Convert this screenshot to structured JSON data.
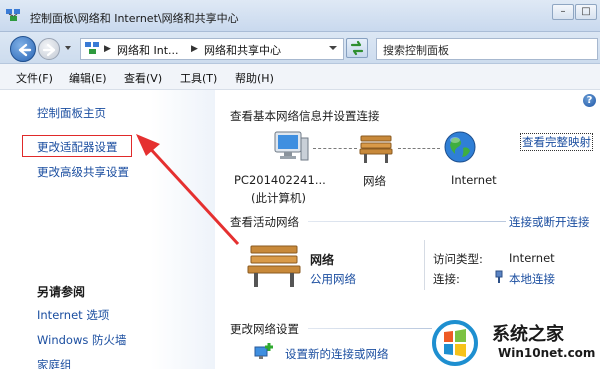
{
  "window": {
    "title": "控制面板\\网络和 Internet\\网络和共享中心",
    "minimize_label": "–",
    "maximize_label": "□"
  },
  "addressbar": {
    "crumbs": [
      "网络和 Int...",
      "网络和共享中心"
    ],
    "search_placeholder": "搜索控制面板"
  },
  "menu": {
    "items": [
      "文件(F)",
      "编辑(E)",
      "查看(V)",
      "工具(T)",
      "帮助(H)"
    ]
  },
  "sidebar": {
    "links": [
      "控制面板主页",
      "更改适配器设置",
      "更改高级共享设置"
    ],
    "see_also_heading": "另请参阅",
    "see_also": [
      "Internet 选项",
      "Windows 防火墙",
      "家庭组"
    ]
  },
  "main": {
    "basic_title": "查看基本网络信息并设置连接",
    "full_map_link": "查看完整映射",
    "nodes": {
      "computer_name": "PC201402241...",
      "computer_sub": "(此计算机)",
      "network": "网络",
      "internet": "Internet"
    },
    "active_title": "查看活动网络",
    "connect_link": "连接或断开连接",
    "active_network": {
      "name": "网络",
      "type": "公用网络",
      "access_label": "访问类型:",
      "access_value": "Internet",
      "conn_label": "连接:",
      "conn_value": "本地连接"
    },
    "change_title": "更改网络设置",
    "setup_link": "设置新的连接或网络"
  },
  "watermark": {
    "title": "系统之家",
    "url": "Win10net.com"
  },
  "colors": {
    "link": "#1b4ea0",
    "highlight": "#e02a2a"
  }
}
